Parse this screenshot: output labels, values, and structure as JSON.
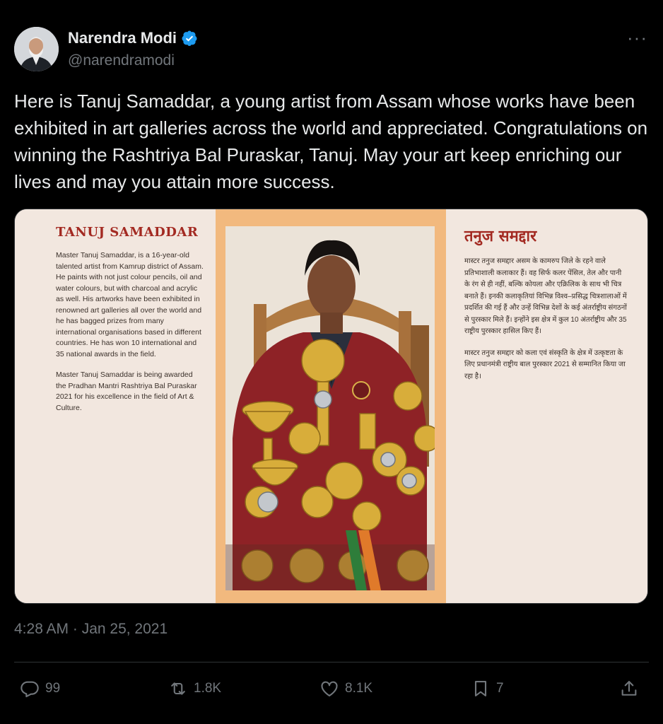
{
  "author": {
    "name": "Narendra Modi",
    "handle": "@narendramodi"
  },
  "tweet": {
    "text": "Here is Tanuj Samaddar, a young artist from Assam whose works have been exhibited in art galleries across the world and appreciated. Congratulations on winning the Rashtriya Bal Puraskar, Tanuj. May your art keep enriching our lives and may you attain more success.",
    "timestamp": "4:28 AM · Jan 25, 2021"
  },
  "media": {
    "english_title": "TANUJ SAMADDAR",
    "english_paragraphs": [
      "Master Tanuj Samaddar, is a 16-year-old talented artist from Kamrup district of Assam. He paints with not just colour pencils, oil and water colours, but with charcoal and acrylic as well. His artworks have been exhibited in renowned art galleries all over the world and he has bagged prizes from many international organisations based in different countries. He has won 10 international and 35 national awards in the field.",
      "Master Tanuj Samaddar is being awarded the Pradhan Mantri Rashtriya Bal Puraskar 2021 for his excellence in the field of Art & Culture."
    ],
    "hindi_title": "तनुज समद्दार",
    "hindi_paragraphs": [
      "मास्टर तनुज समद्दार असम के कामरुप जिले के रहने वाले प्रतिभाशाली कलाकार हैं। वह सिर्फ कलर पेंसिल, तेल और पानी के रंग से ही नहीं, बल्कि कोयला और एक्रिलिक के साथ भी चित्र बनाते हैं। इनकी कलाकृतियां विभिन्न विश्व–प्रसिद्ध चित्रशालाओं में प्रदर्शित की गई हैं और उन्हें विभिन्न देशों के कई अंतर्राष्ट्रीय संगठनों से पुरस्कार मिले हैं। इन्होंने इस क्षेत्र में कुल 10 अंतर्राष्ट्रीय और 35 राष्ट्रीय पुरस्कार हासिल किए हैं।",
      "मास्टर तनुज समद्दार को कला एवं संस्कृति के क्षेत्र में उत्कृष्टता के लिए प्रधानमंत्री राष्ट्रीय बाल पुरस्कार 2021 से सम्मानित किया जा रहा है।"
    ]
  },
  "actions": {
    "replies": "99",
    "retweets": "1.8K",
    "likes": "8.1K",
    "bookmarks": "7"
  },
  "icons": {
    "verified": "verified-badge-icon",
    "more": "more-dots-icon",
    "reply": "reply-icon",
    "retweet": "retweet-icon",
    "like": "heart-icon",
    "bookmark": "bookmark-icon",
    "share": "share-icon"
  },
  "colors": {
    "background": "#000000",
    "text": "#e7e9ea",
    "muted": "#71767b",
    "verified": "#1d9bf0",
    "title_red": "#a32a22",
    "frame_orange": "#f2b97e"
  }
}
